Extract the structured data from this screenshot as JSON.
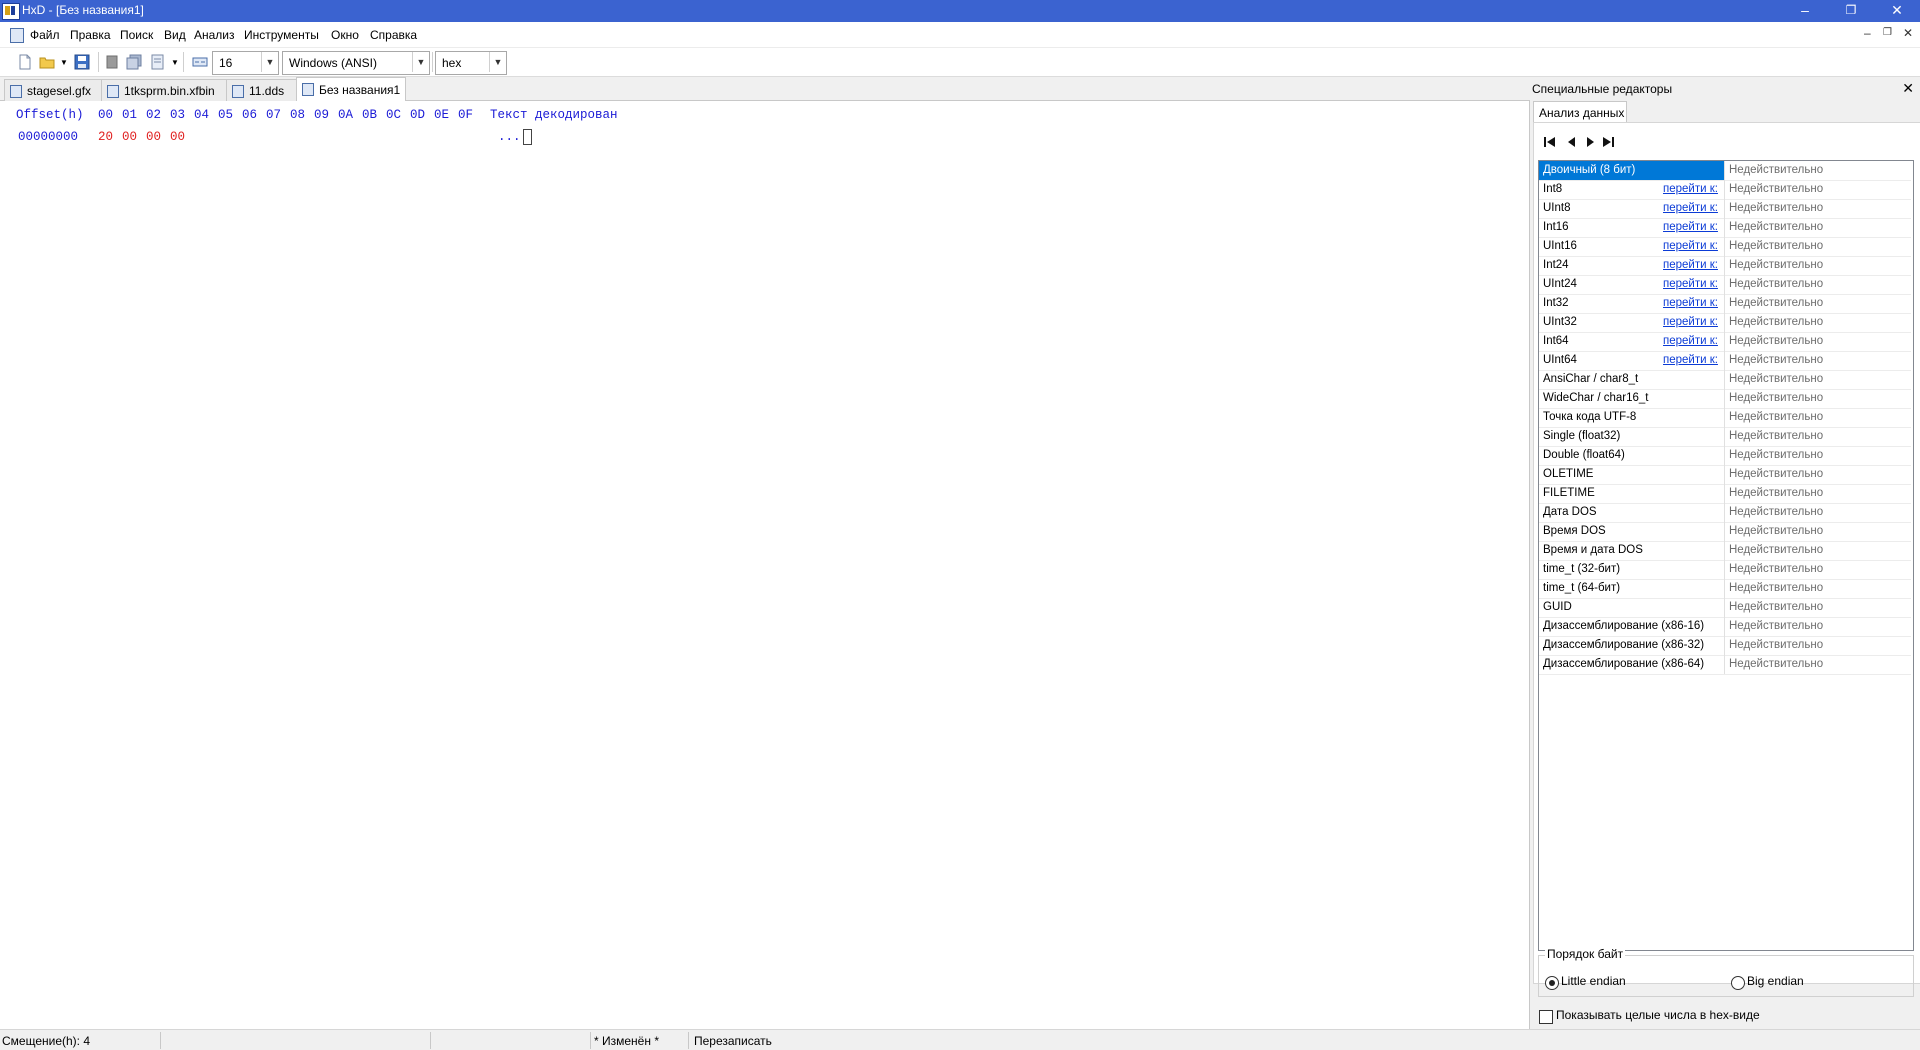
{
  "window": {
    "title": "HxD - [Без названия1]",
    "minimize": "–",
    "restore": "❐",
    "close": "✕"
  },
  "menu": [
    "Файл",
    "Правка",
    "Поиск",
    "Вид",
    "Анализ",
    "Инструменты",
    "Окно",
    "Справка"
  ],
  "mdi_controls": {
    "minimize": "–",
    "restore": "❐",
    "close": "✕"
  },
  "toolbar": {
    "bytes_per_row": "16",
    "charset": "Windows (ANSI)",
    "offset_base": "hex"
  },
  "tabs": [
    {
      "label": "stagesel.gfx",
      "active": false
    },
    {
      "label": "1tksprm.bin.xfbin",
      "active": false
    },
    {
      "label": "11.dds",
      "active": false
    },
    {
      "label": "Без названия1",
      "active": true
    }
  ],
  "hex": {
    "offset_header": "Offset(h)",
    "column_headers": [
      "00",
      "01",
      "02",
      "03",
      "04",
      "05",
      "06",
      "07",
      "08",
      "09",
      "0A",
      "0B",
      "0C",
      "0D",
      "0E",
      "0F"
    ],
    "text_header": "Текст декодирован",
    "rows": [
      {
        "offset": "00000000",
        "bytes": [
          "20",
          "00",
          "00",
          "00"
        ],
        "text": "..."
      }
    ],
    "colors": {
      "header": "#1b1bd6",
      "offset": "#1b1bd6",
      "bytes": "#e02020",
      "text": "#1b1bd6"
    }
  },
  "panel": {
    "title": "Специальные редакторы",
    "close": "✕",
    "tab": "Анализ данных",
    "goto_label": "перейти к:",
    "rows": [
      {
        "name": "Двоичный (8 бит)",
        "value": "Недействительно",
        "goto": false,
        "selected": true
      },
      {
        "name": "Int8",
        "value": "Недействительно",
        "goto": true
      },
      {
        "name": "UInt8",
        "value": "Недействительно",
        "goto": true
      },
      {
        "name": "Int16",
        "value": "Недействительно",
        "goto": true
      },
      {
        "name": "UInt16",
        "value": "Недействительно",
        "goto": true
      },
      {
        "name": "Int24",
        "value": "Недействительно",
        "goto": true
      },
      {
        "name": "UInt24",
        "value": "Недействительно",
        "goto": true
      },
      {
        "name": "Int32",
        "value": "Недействительно",
        "goto": true
      },
      {
        "name": "UInt32",
        "value": "Недействительно",
        "goto": true
      },
      {
        "name": "Int64",
        "value": "Недействительно",
        "goto": true
      },
      {
        "name": "UInt64",
        "value": "Недействительно",
        "goto": true
      },
      {
        "name": "AnsiChar / char8_t",
        "value": "Недействительно",
        "goto": false
      },
      {
        "name": "WideChar / char16_t",
        "value": "Недействительно",
        "goto": false
      },
      {
        "name": "Точка кода UTF-8",
        "value": "Недействительно",
        "goto": false
      },
      {
        "name": "Single (float32)",
        "value": "Недействительно",
        "goto": false
      },
      {
        "name": "Double (float64)",
        "value": "Недействительно",
        "goto": false
      },
      {
        "name": "OLETIME",
        "value": "Недействительно",
        "goto": false
      },
      {
        "name": "FILETIME",
        "value": "Недействительно",
        "goto": false
      },
      {
        "name": "Дата DOS",
        "value": "Недействительно",
        "goto": false
      },
      {
        "name": "Время DOS",
        "value": "Недействительно",
        "goto": false
      },
      {
        "name": "Время и дата DOS",
        "value": "Недействительно",
        "goto": false
      },
      {
        "name": "time_t (32-бит)",
        "value": "Недействительно",
        "goto": false
      },
      {
        "name": "time_t (64-бит)",
        "value": "Недействительно",
        "goto": false
      },
      {
        "name": "GUID",
        "value": "Недействительно",
        "goto": false
      },
      {
        "name": "Дизассемблирование (x86-16)",
        "value": "Недействительно",
        "goto": false
      },
      {
        "name": "Дизассемблирование (x86-32)",
        "value": "Недействительно",
        "goto": false
      },
      {
        "name": "Дизассемблирование (x86-64)",
        "value": "Недействительно",
        "goto": false
      }
    ],
    "byte_order": {
      "label": "Порядок байт",
      "little": "Little endian",
      "big": "Big endian",
      "selected": "little"
    },
    "show_hex_checkbox": {
      "label": "Показывать целые числа в hex-виде",
      "checked": false
    }
  },
  "status": {
    "offset": "Смещение(h): 4",
    "modified": "* Изменён *",
    "mode": "Перезаписать"
  }
}
